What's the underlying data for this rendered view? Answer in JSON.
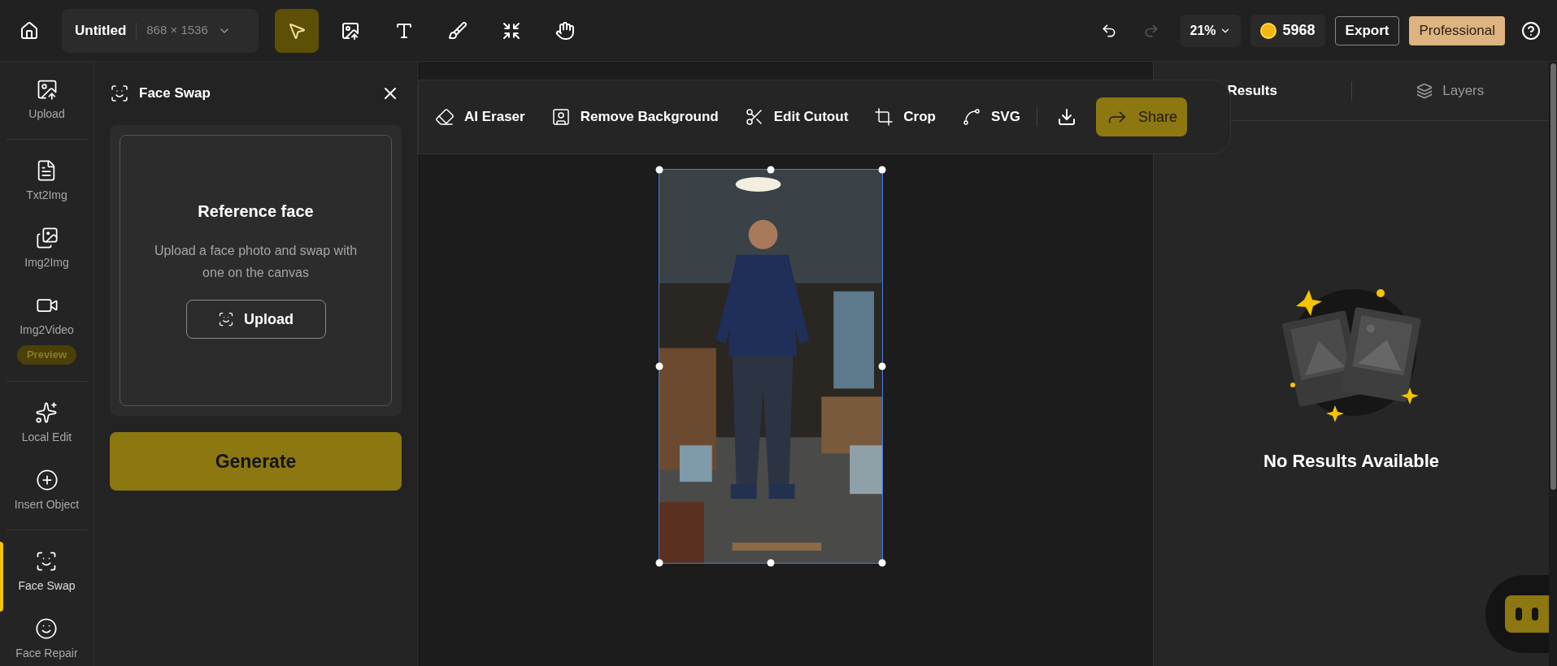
{
  "top_bar": {
    "title": "Untitled",
    "size": "868 × 1536",
    "tools": [
      {
        "kind": "select",
        "selected": true
      },
      {
        "kind": "upload",
        "selected": false
      },
      {
        "kind": "text",
        "selected": false
      },
      {
        "kind": "brush",
        "selected": false
      },
      {
        "kind": "shrink",
        "selected": false
      },
      {
        "kind": "hand",
        "selected": false
      }
    ],
    "undo": {
      "disabled": false
    },
    "redo": {
      "disabled": true
    },
    "zoom": "21%",
    "credits": "5968",
    "export": "Export",
    "plan": "Professional"
  },
  "rail": {
    "groups": [
      {
        "items": [
          {
            "kind": "upload",
            "label": "Upload",
            "selected": false
          }
        ]
      },
      {
        "items": [
          {
            "kind": "txt2img",
            "label": "Txt2Img",
            "selected": false
          },
          {
            "kind": "img2img",
            "label": "Img2Img",
            "selected": false
          },
          {
            "kind": "video",
            "label": "Img2Video",
            "badge": "Preview",
            "selected": false
          }
        ]
      },
      {
        "items": [
          {
            "kind": "local",
            "label": "Local Edit",
            "selected": false
          },
          {
            "kind": "insert",
            "label": "Insert Object",
            "selected": false
          }
        ]
      },
      {
        "items": [
          {
            "kind": "faceswap",
            "label": "Face Swap",
            "selected": true
          },
          {
            "kind": "facerepair",
            "label": "Face Repair",
            "selected": false
          }
        ]
      }
    ]
  },
  "panel": {
    "title": "Face Swap",
    "card_title": "Reference face",
    "description": "Upload a face photo and swap with one on the canvas",
    "upload": "Upload",
    "generate": "Generate"
  },
  "toolbar": {
    "items": [
      {
        "kind": "eraser",
        "label": "AI Eraser"
      },
      {
        "kind": "background",
        "label": "Remove Background"
      },
      {
        "kind": "cutout",
        "label": "Edit Cutout"
      },
      {
        "kind": "crop",
        "label": "Crop"
      },
      {
        "kind": "svg",
        "label": "SVG"
      }
    ],
    "share": "Share"
  },
  "right_panel": {
    "tabs": [
      {
        "label": "Results",
        "selected": true
      },
      {
        "label": "Layers",
        "selected": false
      }
    ],
    "empty": "No Results Available"
  }
}
